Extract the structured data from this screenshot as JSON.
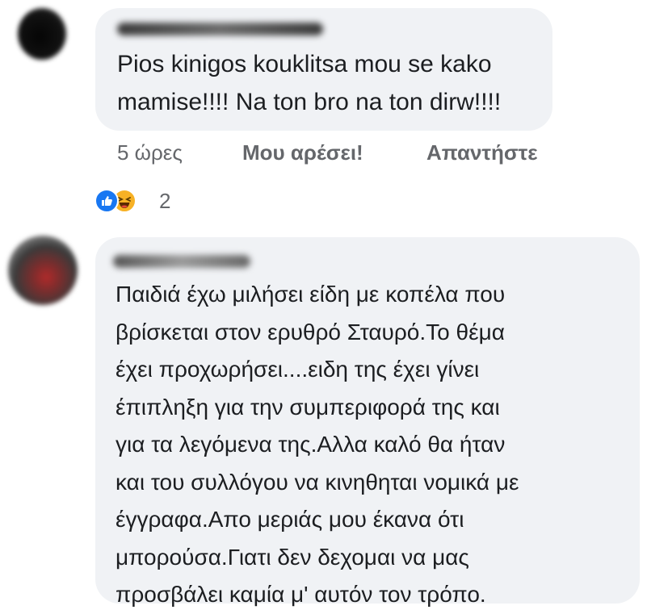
{
  "comments": [
    {
      "author": "Pan... Karamanas",
      "text": "Pios kinigos kouklitsa mou se kako\nmamise!!!! Na ton bro na ton dirw!!!!",
      "time": "5 ώρες",
      "like_label": "Μου αρέσει!",
      "reply_label": "Απαντήστε",
      "reactions": {
        "count": "2",
        "icons": [
          "like-reaction-icon",
          "haha-reaction-icon"
        ]
      }
    },
    {
      "author": "",
      "text": "Παιδιά έχω μιλήσει είδη με κοπέλα που\nβρίσκεται στον ερυθρό Σταυρό.Το θέμα\nέχει προχωρήσει....ειδη της έχει γίνει\nέπιπληξη για την συμπεριφορά της και\nγια τα λεγόμενα της.Αλλα καλό θα ήταν\nκαι του συλλόγου να κινηθηται νομικά με\nέγγραφα.Απο μεριάς μου έκανα ότι\nμπορούσα.Γιατι δεν δεχομαι να μας\nπροσβάλει καμία μ' αυτόν τον τρόπο."
    }
  ],
  "colors": {
    "bubble": "#f0f2f5",
    "text": "#1c1e21",
    "meta": "#65676b",
    "like_blue": "#1877f2",
    "haha_yellow": "#f7b125"
  }
}
